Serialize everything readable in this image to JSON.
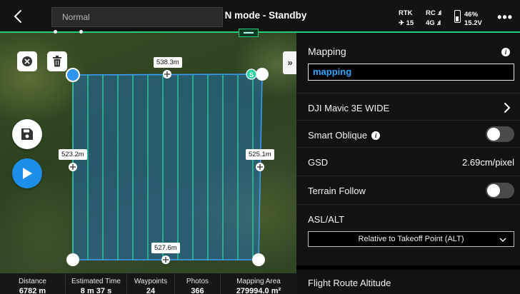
{
  "topbar": {
    "mode_dropdown": "Normal",
    "flight_mode": "N mode - Standby",
    "rtk_label": "RTK",
    "satellite_count": "15",
    "rc_label": "RC",
    "network_label": "4G",
    "battery_percent": "46%",
    "battery_voltage": "15.2V",
    "more_icon": "more-dots-icon"
  },
  "map": {
    "top_distance": "538.3m",
    "left_distance": "523.2m",
    "right_distance": "525.1m",
    "bottom_distance": "527.6m",
    "start_marker": "S",
    "route_color": "#2bd4a0",
    "boundary_color": "#3aa0ff"
  },
  "stats": [
    {
      "label": "Distance",
      "value": "6782 m"
    },
    {
      "label": "Estimated Time",
      "value": "8 m 37 s"
    },
    {
      "label": "Waypoints",
      "value": "24"
    },
    {
      "label": "Photos",
      "value": "366"
    },
    {
      "label": "Mapping Area",
      "value": "279994.0 m²"
    }
  ],
  "panel": {
    "title": "Mapping",
    "name_value": "mapping",
    "camera": "DJI Mavic 3E WIDE",
    "smart_oblique_label": "Smart Oblique",
    "smart_oblique_on": false,
    "gsd_label": "GSD",
    "gsd_value": "2.69cm/pixel",
    "terrain_follow_label": "Terrain Follow",
    "terrain_follow_on": false,
    "asl_alt_label": "ASL/ALT",
    "altitude_mode_value": "Relative to Takeoff Point (ALT)",
    "flight_route_altitude_label": "Flight Route Altitude"
  },
  "colors": {
    "accent_green": "#1fcf80",
    "accent_blue": "#1e8fe8",
    "panel_bg": "#121212"
  }
}
